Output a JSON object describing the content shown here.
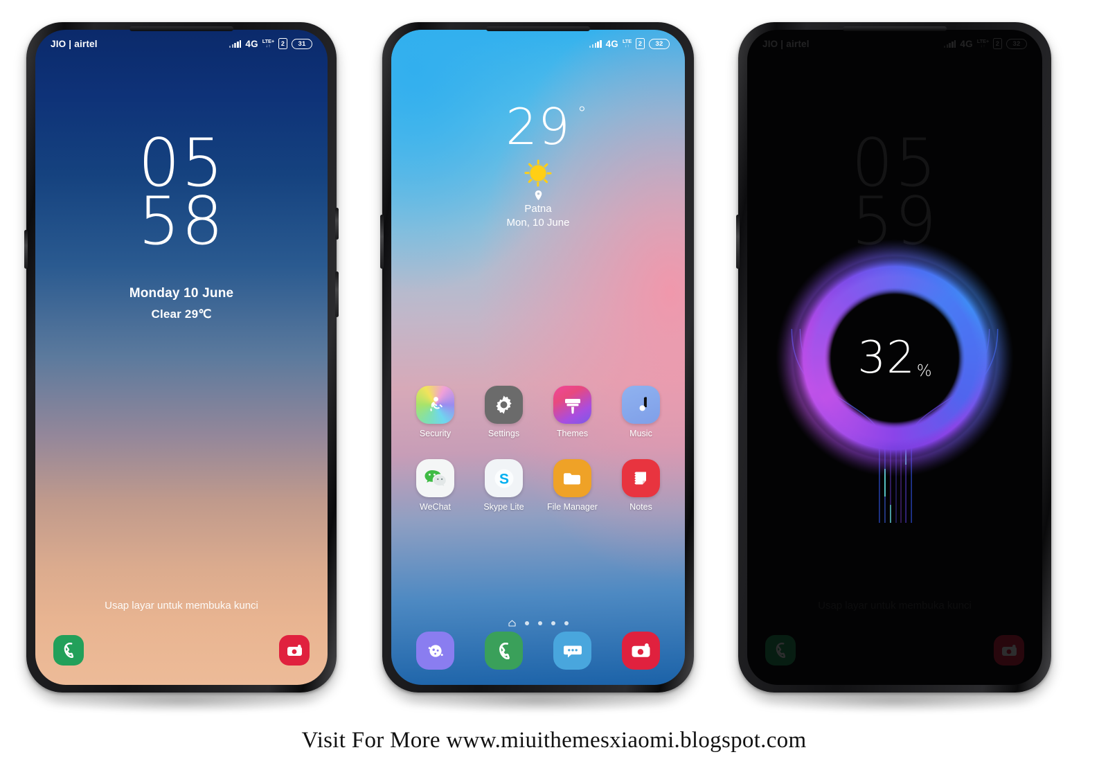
{
  "footer": {
    "text": "Visit For More www.miuithemesxiaomi.blogspot.com"
  },
  "phone1": {
    "name": "lock-screen-phone",
    "statusbar": {
      "carrier": "JIO | airtel",
      "network": "4G",
      "lte_top": "LTE",
      "lte_plus": "+",
      "lte_bottom": "↓↑",
      "sim": "2",
      "battery": "31"
    },
    "clock": {
      "hours": "05",
      "minutes": "58"
    },
    "date": "Monday 10 June",
    "weather": "Clear 29℃",
    "unlock_hint": "Usap layar untuk membuka kunci",
    "shortcuts": [
      {
        "name": "phone-shortcut",
        "icon": "phone-icon",
        "color": "#22a05a"
      },
      {
        "name": "camera-shortcut",
        "icon": "camera-icon",
        "color": "#e0213e"
      }
    ]
  },
  "phone2": {
    "name": "home-screen-phone",
    "statusbar": {
      "carrier": "",
      "network": "4G",
      "lte_top": "LTE",
      "lte_plus": "",
      "lte_bottom": "↓↑",
      "sim": "2",
      "battery": "32"
    },
    "weather_widget": {
      "temperature": "29",
      "degree": "°",
      "condition_icon": "sun-icon",
      "location_icon": "location-pin-icon",
      "city": "Patna",
      "date": "Mon, 10 June"
    },
    "app_rows": [
      [
        {
          "label": "Security",
          "icon": "security-icon"
        },
        {
          "label": "Settings",
          "icon": "gear-icon"
        },
        {
          "label": "Themes",
          "icon": "paint-brush-icon"
        },
        {
          "label": "Music",
          "icon": "music-note-icon"
        }
      ],
      [
        {
          "label": "WeChat",
          "icon": "wechat-icon"
        },
        {
          "label": "Skype Lite",
          "icon": "skype-icon"
        },
        {
          "label": "File Manager",
          "icon": "folder-icon"
        },
        {
          "label": "Notes",
          "icon": "notes-icon"
        }
      ]
    ],
    "page_indicator": {
      "home_icon": "home-icon",
      "dots": 4,
      "active_page": 0
    },
    "dock": [
      {
        "name": "contacts",
        "icon": "contacts-icon"
      },
      {
        "name": "phone",
        "icon": "phone-icon"
      },
      {
        "name": "messages",
        "icon": "messages-icon"
      },
      {
        "name": "camera",
        "icon": "camera-icon"
      }
    ]
  },
  "phone3": {
    "name": "charging-screen-phone",
    "statusbar": {
      "carrier": "JIO | airtel",
      "network": "4G",
      "lte_top": "LTE",
      "lte_plus": "+",
      "lte_bottom": "↓↑",
      "sim": "2",
      "battery": "32"
    },
    "clock": {
      "hours": "05",
      "minutes": "59"
    },
    "unlock_hint": "Usap layar untuk membuka kunci",
    "charging": {
      "percent": "32",
      "symbol": "%"
    },
    "shortcuts": [
      {
        "name": "phone-shortcut",
        "icon": "phone-icon"
      },
      {
        "name": "camera-shortcut",
        "icon": "camera-icon"
      }
    ]
  },
  "colors": {
    "accent_green": "#22a05a",
    "accent_red": "#e0213e",
    "accent_blue": "#49a6dd",
    "charge_purple": "#a24ce8",
    "charge_blue": "#4d6ef2"
  }
}
